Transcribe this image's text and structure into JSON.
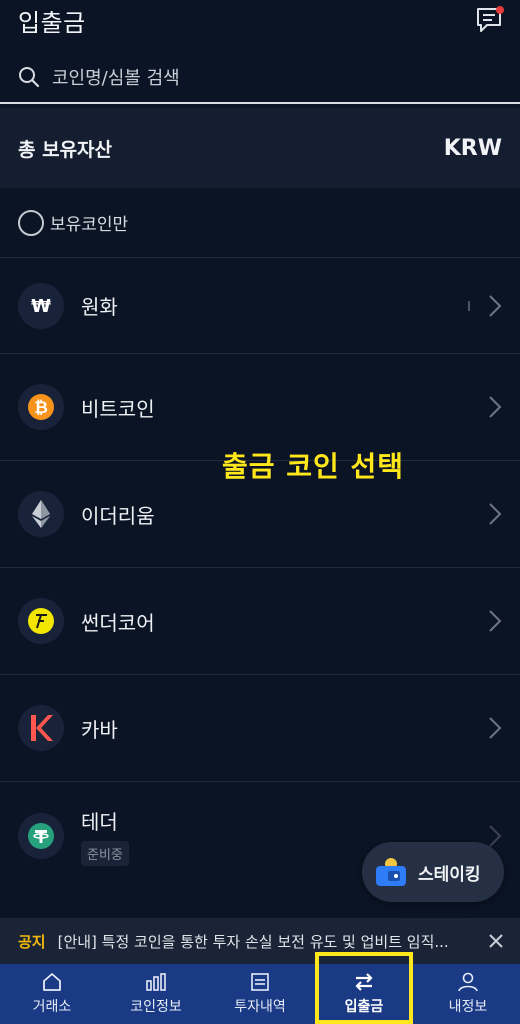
{
  "header": {
    "title": "입출금"
  },
  "search": {
    "placeholder": "코인명/심볼 검색"
  },
  "total": {
    "label": "총 보유자산",
    "currency": "KRW"
  },
  "filter": {
    "label": "보유코인만"
  },
  "coins": [
    {
      "name": "원화",
      "icon": "won-icon",
      "badge": ""
    },
    {
      "name": "비트코인",
      "icon": "bitcoin-icon",
      "badge": ""
    },
    {
      "name": "이더리움",
      "icon": "ethereum-icon",
      "badge": ""
    },
    {
      "name": "썬더코어",
      "icon": "thundercore-icon",
      "badge": ""
    },
    {
      "name": "카바",
      "icon": "kava-icon",
      "badge": ""
    },
    {
      "name": "테더",
      "icon": "tether-icon",
      "badge": "준비중"
    }
  ],
  "overlay_label": "출금 코인 선택",
  "staking": {
    "label": "스테이킹"
  },
  "notice": {
    "tag": "공지",
    "message": "[안내] 특정 코인을 통한 투자 손실 보전 유도 및 업비트 임직..."
  },
  "tabs": [
    {
      "label": "거래소",
      "icon": "home-icon"
    },
    {
      "label": "코인정보",
      "icon": "chart-icon"
    },
    {
      "label": "투자내역",
      "icon": "list-icon"
    },
    {
      "label": "입출금",
      "icon": "transfer-icon",
      "active": true
    },
    {
      "label": "내정보",
      "icon": "user-icon"
    }
  ],
  "colors": {
    "background": "#0b1425",
    "tabbar": "#1a3a86",
    "highlight": "#ffe71c",
    "bitcoin": "#f7931a",
    "tether": "#26a17b",
    "kava": "#ff564f"
  }
}
